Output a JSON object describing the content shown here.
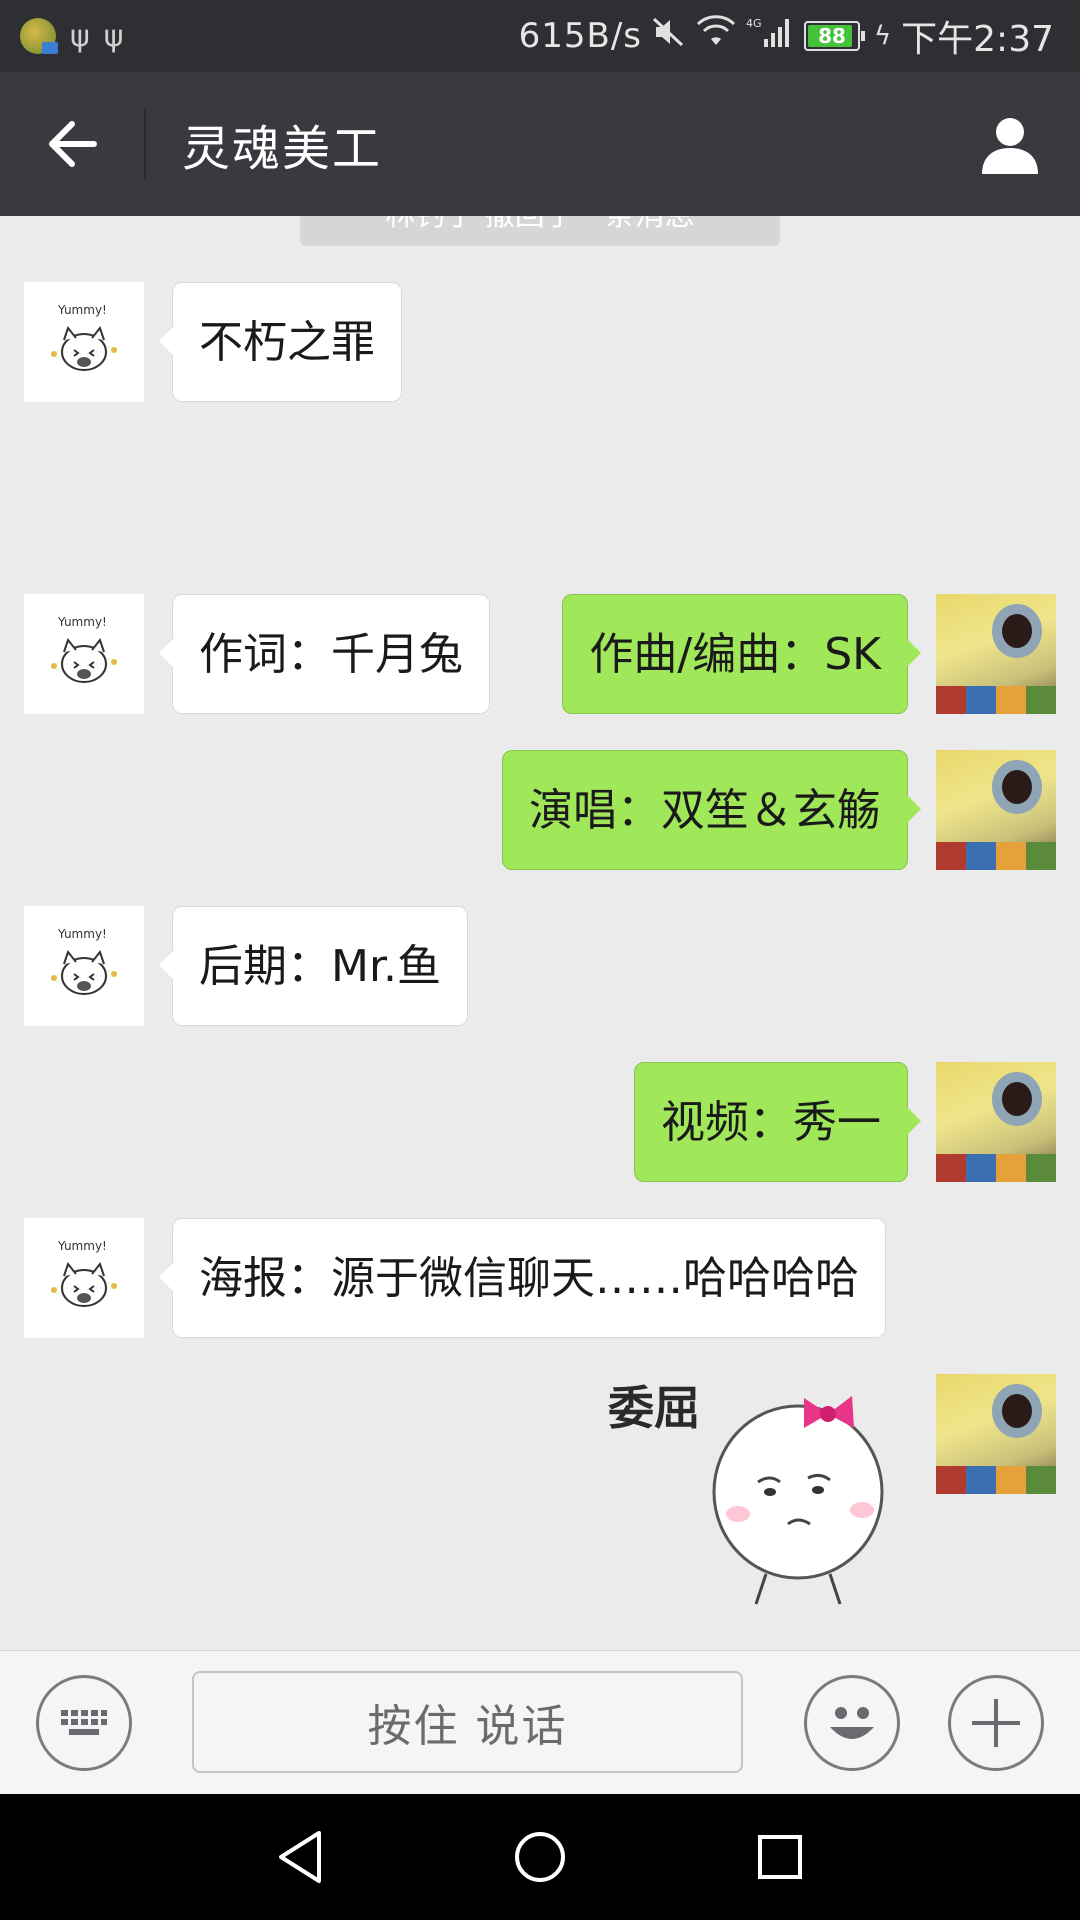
{
  "status_bar": {
    "net_speed": "615B/s",
    "network_type": "4G",
    "battery": "88",
    "time": "下午2:37"
  },
  "header": {
    "title": "灵魂美工"
  },
  "chat": {
    "system_notice": "林钓了 撤回了一条消息",
    "messages": [
      {
        "side": "left",
        "text": "不朽之罪"
      },
      {
        "side": "right",
        "text": "作曲/编曲：SK"
      },
      {
        "side": "left",
        "text": "作词：千月兔"
      },
      {
        "side": "right",
        "text": "演唱：双笙＆玄觞"
      },
      {
        "side": "left",
        "text": "后期：Mr.鱼"
      },
      {
        "side": "right",
        "text": "视频：秀一"
      },
      {
        "side": "left",
        "text": "海报：源于微信聊天……哈哈哈哈"
      }
    ],
    "sticker_caption": "委屈",
    "left_avatar_caption": "Yummy!"
  },
  "input_bar": {
    "hold_to_talk_label": "按住 说话"
  },
  "colors": {
    "title_bar": "#393a3f",
    "chat_bg": "#ebebeb",
    "my_bubble": "#a0e75a",
    "other_bubble": "#ffffff"
  },
  "icons": [
    "back-arrow-icon",
    "profile-icon",
    "keyboard-icon",
    "emoji-icon",
    "plus-icon",
    "nav-back-icon",
    "nav-home-icon",
    "nav-recents-icon"
  ]
}
